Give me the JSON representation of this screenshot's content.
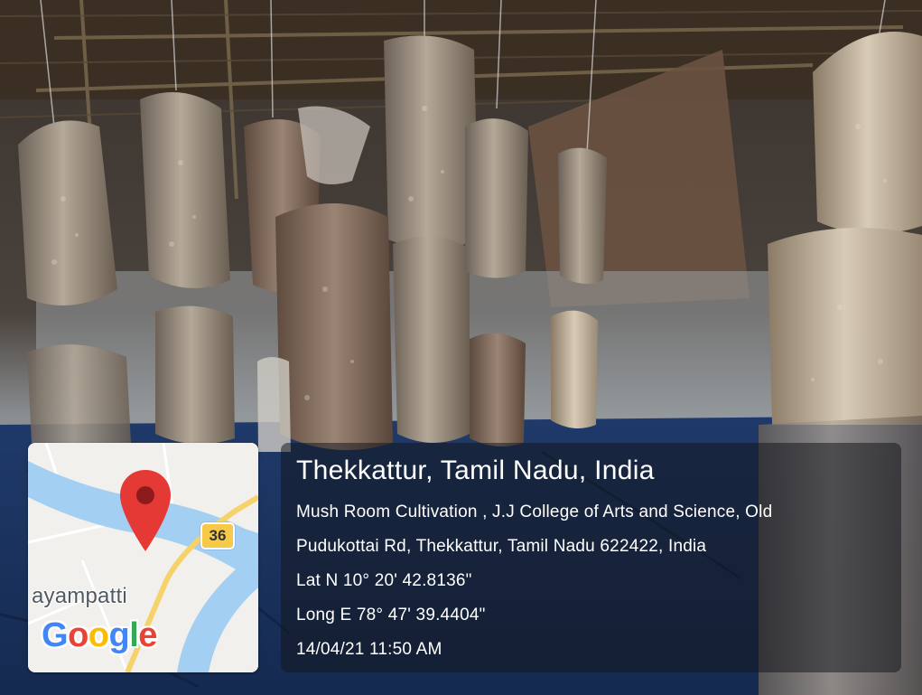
{
  "map": {
    "place_label": "ayampatti",
    "road_number": "36",
    "logo_letters": [
      {
        "ch": "G",
        "color": "#4285F4"
      },
      {
        "ch": "o",
        "color": "#EA4335"
      },
      {
        "ch": "o",
        "color": "#FBBC05"
      },
      {
        "ch": "g",
        "color": "#4285F4"
      },
      {
        "ch": "l",
        "color": "#34A853"
      },
      {
        "ch": "e",
        "color": "#EA4335"
      }
    ],
    "water_color": "#a3cff2",
    "road_color": "#f5d36a",
    "pin_color": "#e53935"
  },
  "location": {
    "title": "Thekkattur, Tamil Nadu, India",
    "address_line1": "Mush Room Cultivation , J.J College of Arts and Science, Old",
    "address_line2": "Pudukottai Rd, Thekkattur, Tamil Nadu 622422, India",
    "latitude": "Lat N 10° 20' 42.8136\"",
    "longitude": "Long E 78° 47' 39.4404\"",
    "timestamp": "14/04/21 11:50 AM"
  }
}
